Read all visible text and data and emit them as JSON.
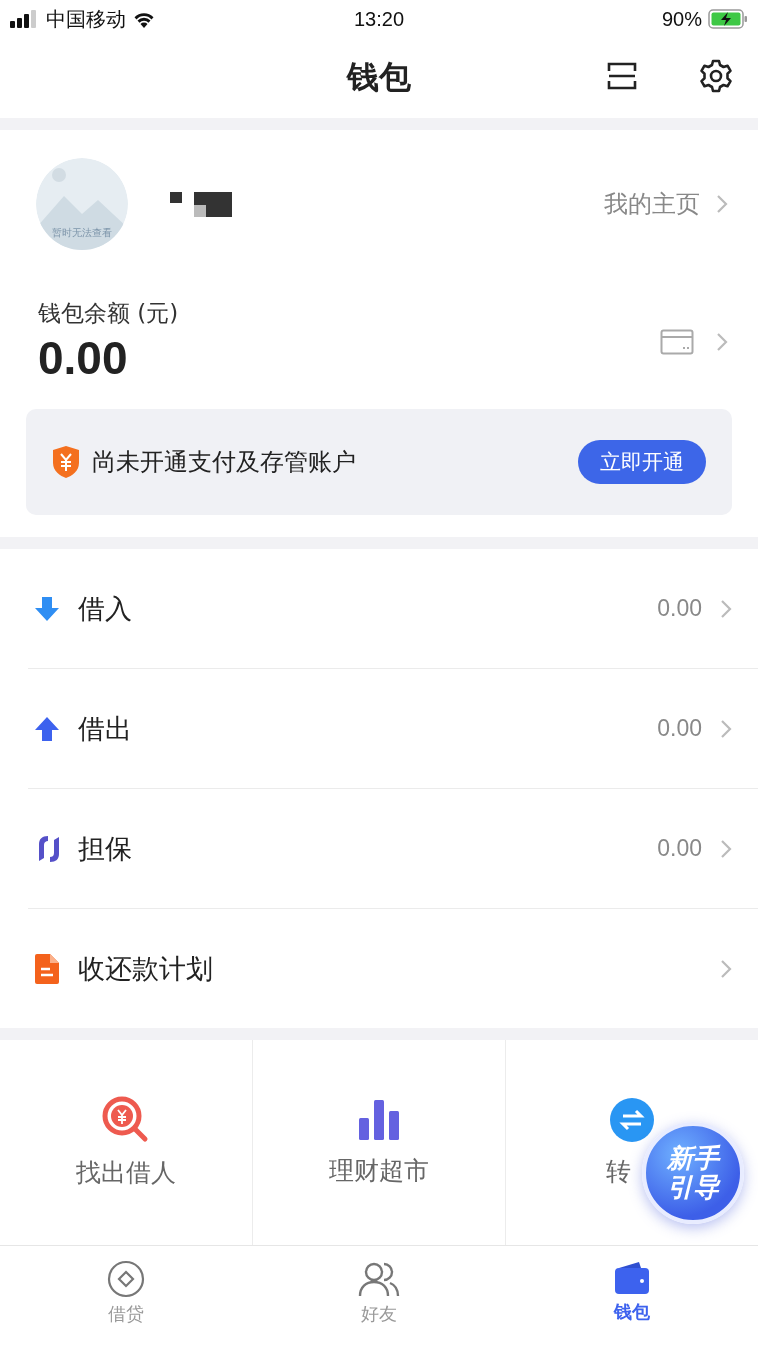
{
  "status_bar": {
    "carrier": "中国移动",
    "time": "13:20",
    "battery": "90%"
  },
  "header": {
    "title": "钱包"
  },
  "profile": {
    "avatar_caption": "暂时无法查看",
    "homepage_link": "我的主页"
  },
  "balance": {
    "label": "钱包余额 (元)",
    "amount": "0.00"
  },
  "notice": {
    "text": "尚未开通支付及存管账户",
    "button": "立即开通"
  },
  "list": [
    {
      "kind": "down",
      "label": "借入",
      "value": "0.00"
    },
    {
      "kind": "up",
      "label": "借出",
      "value": "0.00"
    },
    {
      "kind": "guarantee",
      "label": "担保",
      "value": "0.00"
    },
    {
      "kind": "plan",
      "label": "收还款计划"
    }
  ],
  "grid": [
    {
      "kind": "find",
      "label": "找出借人"
    },
    {
      "kind": "market",
      "label": "理财超市"
    },
    {
      "kind": "transfer",
      "label": "转"
    }
  ],
  "guide_badge": [
    "新手",
    "引导"
  ],
  "tabs": [
    {
      "kind": "loan",
      "label": "借贷",
      "selected": false
    },
    {
      "kind": "friends",
      "label": "好友",
      "selected": false
    },
    {
      "kind": "wallet",
      "label": "钱包",
      "selected": true
    }
  ]
}
